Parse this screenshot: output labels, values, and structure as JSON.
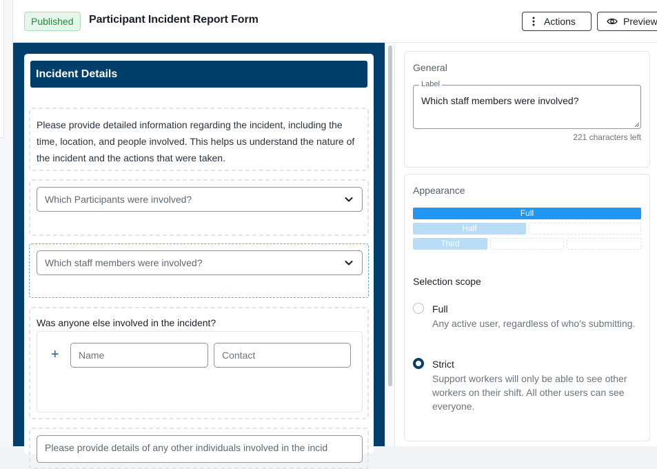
{
  "header": {
    "status_badge": "Published",
    "form_title": "Participant Incident Report Form",
    "actions_label": "Actions",
    "preview_label": "Preview"
  },
  "form": {
    "section_title": "Incident Details",
    "description": "Please provide detailed information regarding the incident, including the time, location, and people involved. This helps us understand the nature of the incident and the actions that were taken.",
    "participants_select": "Which Participants were involved?",
    "staff_select": "Which staff members were involved?",
    "others_question": "Was anyone else involved in the incident?",
    "name_placeholder": "Name",
    "contact_placeholder": "Contact",
    "details_placeholder": "Please provide details of any other individuals involved in the incid"
  },
  "properties": {
    "general": {
      "title": "General",
      "label_legend": "Label",
      "label_value": "Which staff members were involved?",
      "chars_left": "221 characters left"
    },
    "appearance": {
      "title": "Appearance",
      "widths": [
        "Full",
        "Half",
        "Third"
      ],
      "selected_width": "Full",
      "selection_scope_title": "Selection scope",
      "options": [
        {
          "label": "Full",
          "description": "Any active user, regardless of who's submitting.",
          "checked": false
        },
        {
          "label": "Strict",
          "description": "Support workers will only be able to see other workers on their shift. All other users can see everyone.",
          "checked": true
        }
      ]
    }
  },
  "colors": {
    "primary": "#003e6b",
    "width_selected": "#2196f3",
    "width_unselected": "#b9dcf7",
    "published": "#1f8a3e"
  }
}
